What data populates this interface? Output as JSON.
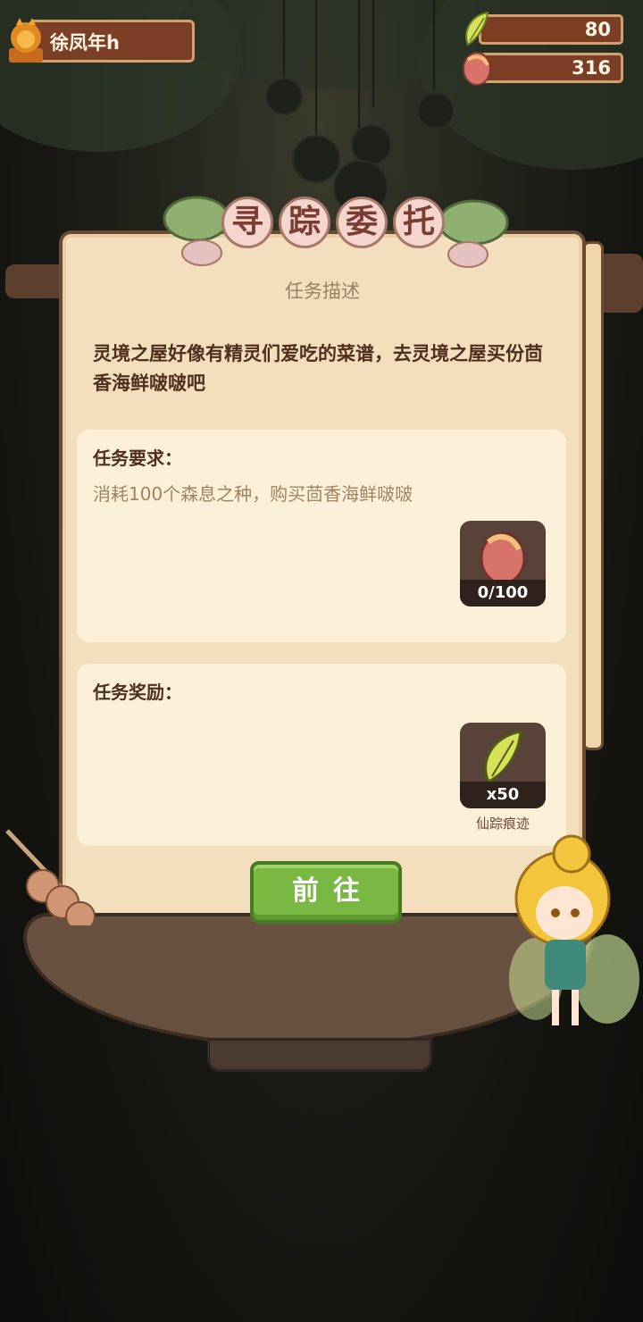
{
  "player": {
    "name": "徐凤年h",
    "avatar_icon": "lion-head-icon"
  },
  "resources": [
    {
      "icon": "fairy-wing-icon",
      "value": "80"
    },
    {
      "icon": "seed-icon",
      "value": "316"
    }
  ],
  "panel": {
    "title_chars": [
      "寻",
      "踪",
      "委",
      "托"
    ],
    "subtitle": "任务描述",
    "description": "灵境之屋好像有精灵们爱吃的菜谱，去灵境之屋买份茴香海鲜啵啵吧",
    "requirement": {
      "label": "任务要求：",
      "text": "消耗100个森息之种，购买茴香海鲜啵啵",
      "item_icon": "seed-icon",
      "progress_text": "0/100",
      "progress": 0
    },
    "reward": {
      "label": "任务奖励：",
      "item_icon": "fairy-wing-icon",
      "count_text": "x50",
      "item_name": "仙踪痕迹"
    },
    "go_button": "前往"
  },
  "colors": {
    "panel_bg": "#f3dfbd",
    "box_bg": "#fcf0d9",
    "button_green": "#79b842",
    "text_brown": "#4f301e",
    "muted_text": "#a1845f"
  }
}
